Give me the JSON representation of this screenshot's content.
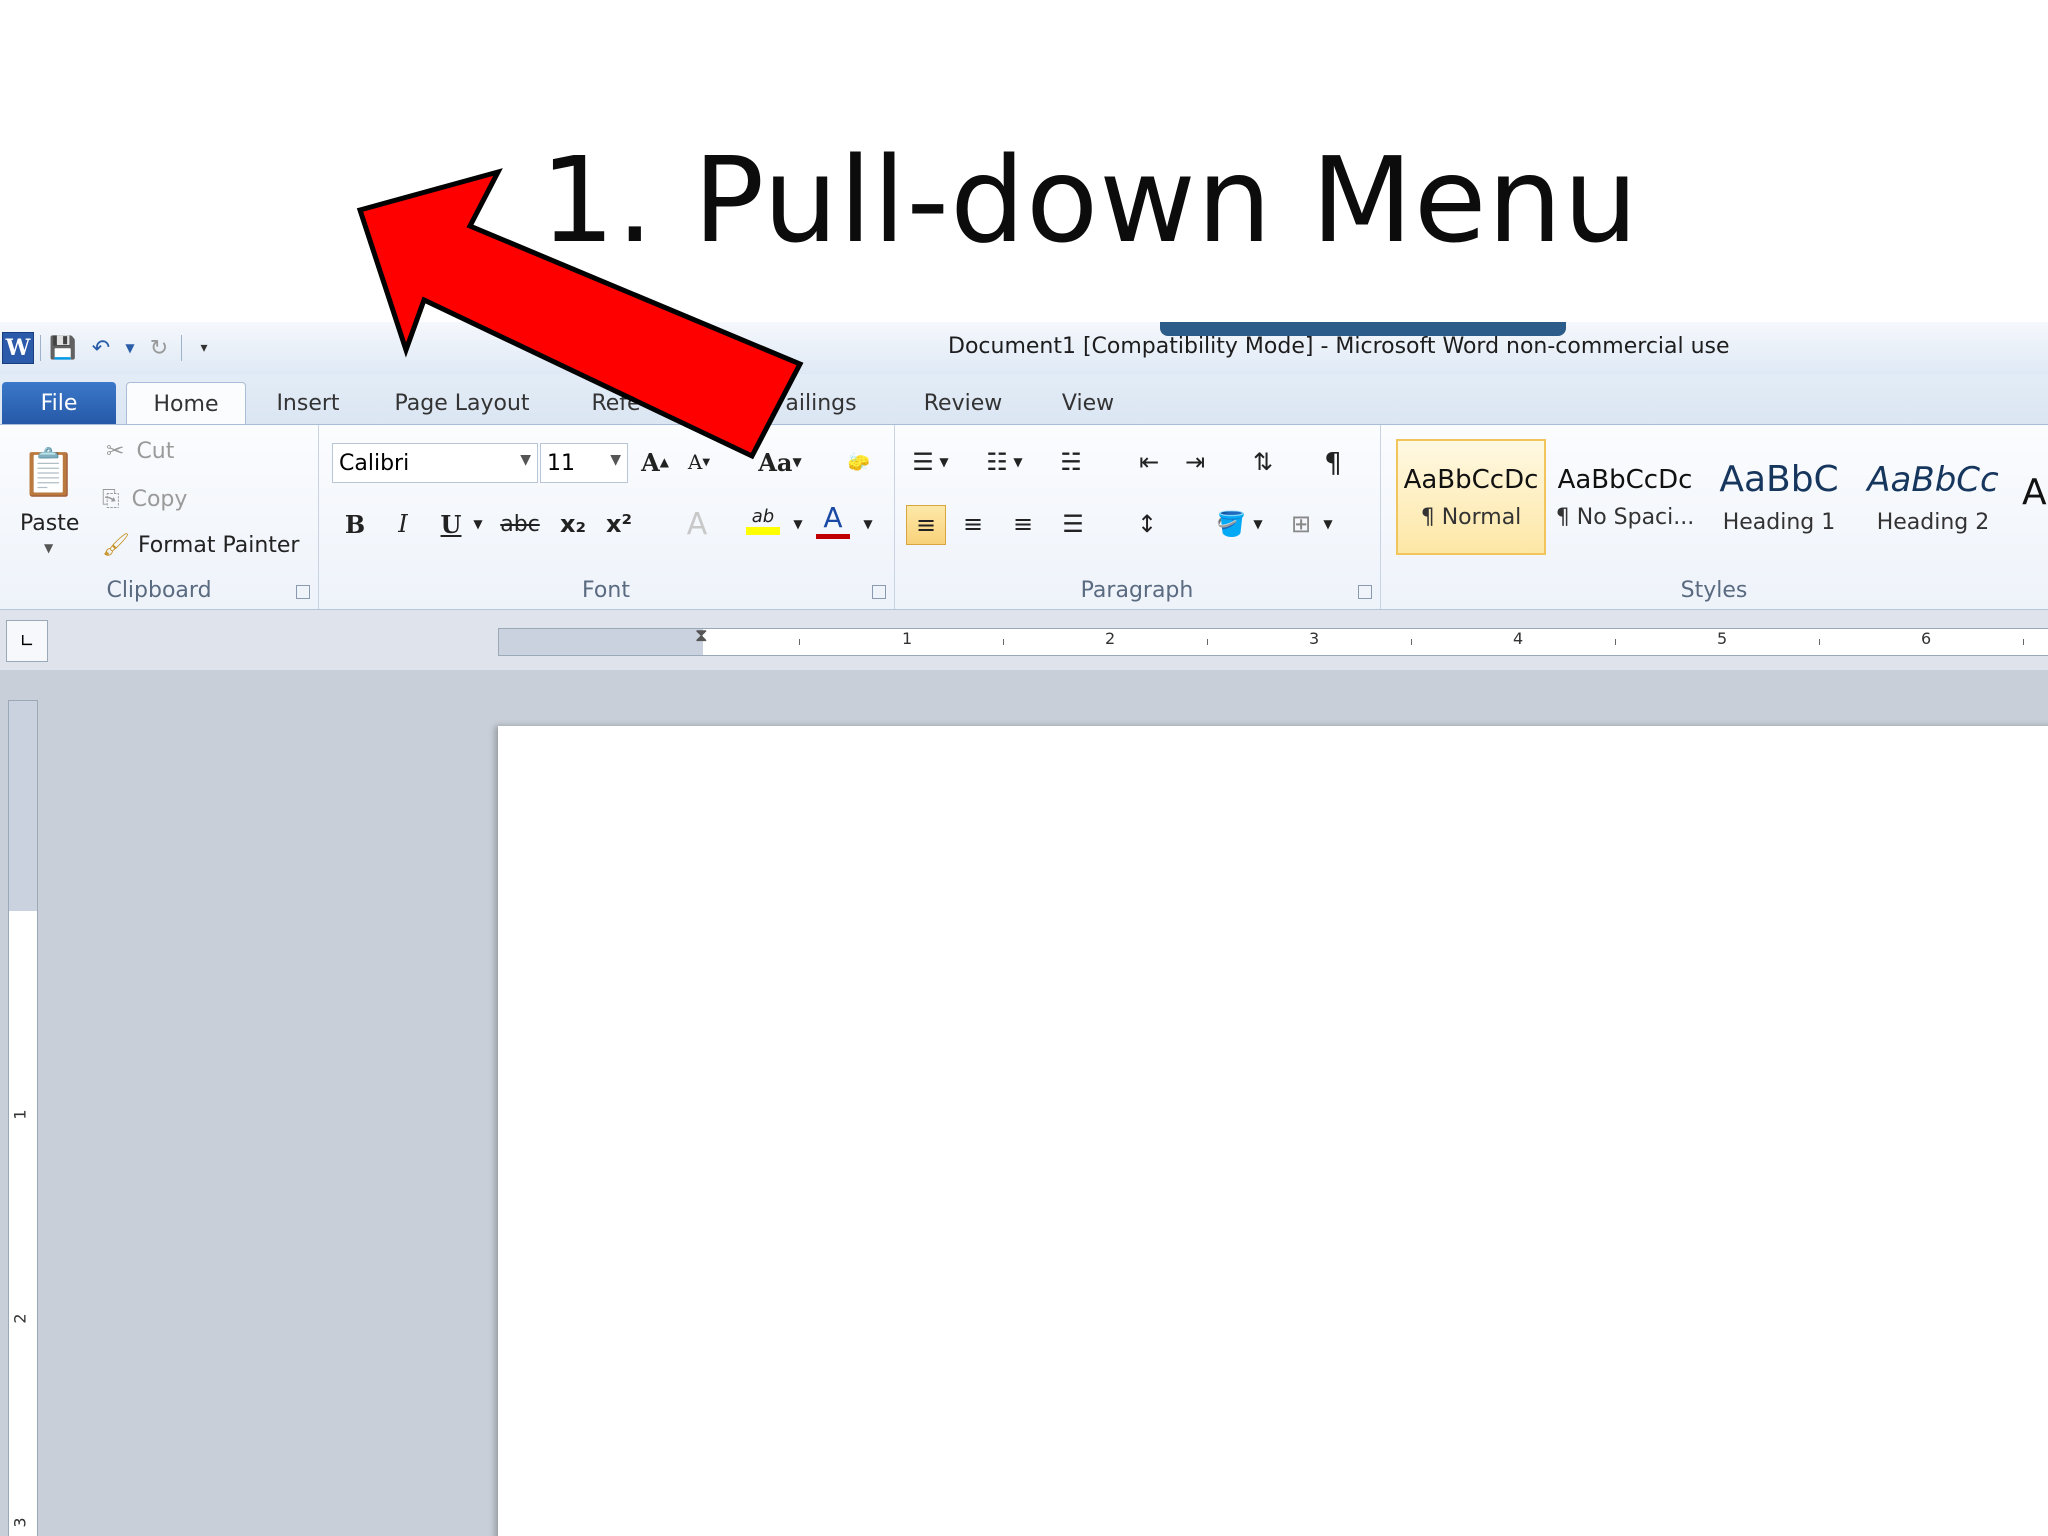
{
  "slide": {
    "title": "1. Pull-down Menu"
  },
  "window": {
    "title": "Document1 [Compatibility Mode]  -  Microsoft Word non-commercial use",
    "qat_logo": "W"
  },
  "tabs": {
    "file": "File",
    "home": "Home",
    "insert": "Insert",
    "page_layout": "Page Layout",
    "references_partial": "Refe",
    "mailings_partial": "ailings",
    "review": "Review",
    "view": "View"
  },
  "clipboard": {
    "paste": "Paste",
    "cut": "Cut",
    "copy": "Copy",
    "format_painter": "Format Painter",
    "label": "Clipboard"
  },
  "font": {
    "name": "Calibri",
    "size": "11",
    "change_case": "Aa",
    "bold": "B",
    "italic": "I",
    "underline": "U",
    "strike": "abc",
    "subscript": "x₂",
    "superscript": "x²",
    "color_glyph": "A",
    "label": "Font"
  },
  "paragraph": {
    "label": "Paragraph",
    "pilcrow": "¶"
  },
  "styles": {
    "label": "Styles",
    "items": [
      {
        "sample": "AaBbCcDc",
        "name": "¶ Normal"
      },
      {
        "sample": "AaBbCcDc",
        "name": "¶ No Spaci..."
      },
      {
        "sample": "AaBbC",
        "name": "Heading 1"
      },
      {
        "sample": "AaBbCc",
        "name": "Heading 2"
      },
      {
        "sample": "A",
        "name": ""
      }
    ]
  },
  "ruler": {
    "h_numbers": [
      "1",
      "2",
      "3",
      "4",
      "5",
      "6"
    ],
    "v_numbers": [
      "1",
      "2",
      "3"
    ]
  },
  "colors": {
    "arrow": "#ff0000",
    "file_tab": "#2b5aab",
    "highlight": "#ffff00",
    "font_color": "#c00000"
  }
}
